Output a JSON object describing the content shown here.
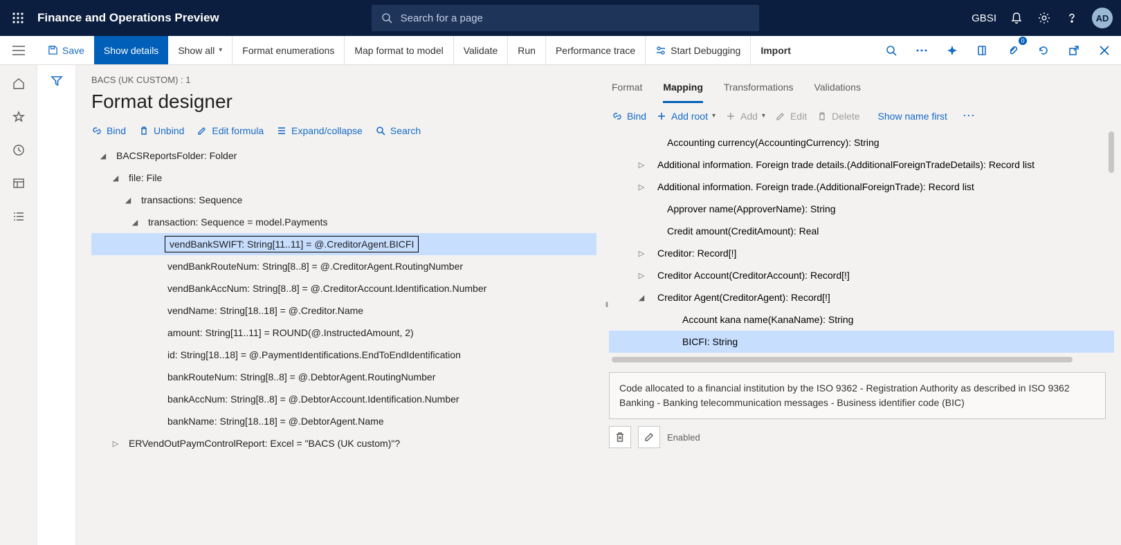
{
  "header": {
    "app_title": "Finance and Operations Preview",
    "search_placeholder": "Search for a page",
    "org": "GBSI",
    "avatar": "AD"
  },
  "commands": {
    "save": "Save",
    "show_details": "Show details",
    "show_all": "Show all",
    "format_enum": "Format enumerations",
    "map_format": "Map format to model",
    "validate": "Validate",
    "run": "Run",
    "perf_trace": "Performance trace",
    "start_debug": "Start Debugging",
    "import": "Import",
    "attach_badge": "0"
  },
  "page": {
    "breadcrumb": "BACS (UK CUSTOM) : 1",
    "title": "Format designer"
  },
  "format_cmds": {
    "bind": "Bind",
    "unbind": "Unbind",
    "edit_formula": "Edit formula",
    "expand": "Expand/collapse",
    "search": "Search"
  },
  "format_tree": [
    {
      "indent": 0,
      "expanded": true,
      "label": "BACSReportsFolder: Folder"
    },
    {
      "indent": 1,
      "expanded": true,
      "label": "file: File"
    },
    {
      "indent": 2,
      "expanded": true,
      "label": "transactions: Sequence"
    },
    {
      "indent": 3,
      "expanded": true,
      "label": "transaction: Sequence = model.Payments"
    },
    {
      "indent": 4,
      "selected": true,
      "label": "vendBankSWIFT: String[11..11] = @.CreditorAgent.BICFI"
    },
    {
      "indent": 4,
      "label": "vendBankRouteNum: String[8..8] = @.CreditorAgent.RoutingNumber"
    },
    {
      "indent": 4,
      "label": "vendBankAccNum: String[8..8] = @.CreditorAccount.Identification.Number"
    },
    {
      "indent": 4,
      "label": "vendName: String[18..18] = @.Creditor.Name"
    },
    {
      "indent": 4,
      "label": "amount: String[11..11] = ROUND(@.InstructedAmount, 2)"
    },
    {
      "indent": 4,
      "label": "id: String[18..18] = @.PaymentIdentifications.EndToEndIdentification"
    },
    {
      "indent": 4,
      "label": "bankRouteNum: String[8..8] = @.DebtorAgent.RoutingNumber"
    },
    {
      "indent": 4,
      "label": "bankAccNum: String[8..8] = @.DebtorAccount.Identification.Number"
    },
    {
      "indent": 4,
      "label": "bankName: String[18..18] = @.DebtorAgent.Name"
    },
    {
      "indent": 1,
      "collapsed": true,
      "label": "ERVendOutPaymControlReport: Excel = \"BACS (UK custom)\"?"
    }
  ],
  "tabs": {
    "format": "Format",
    "mapping": "Mapping",
    "transformations": "Transformations",
    "validations": "Validations"
  },
  "mapping_cmds": {
    "bind": "Bind",
    "add_root": "Add root",
    "add": "Add",
    "edit": "Edit",
    "delete": "Delete",
    "show_name_first": "Show name first"
  },
  "mapping_tree": [
    {
      "indent": 1,
      "label": "Accounting currency(AccountingCurrency): String"
    },
    {
      "indent": 1,
      "collapsed": true,
      "label": "Additional information. Foreign trade details.(AdditionalForeignTradeDetails): Record list"
    },
    {
      "indent": 1,
      "collapsed": true,
      "label": "Additional information. Foreign trade.(AdditionalForeignTrade): Record list"
    },
    {
      "indent": 1,
      "label": "Approver name(ApproverName): String"
    },
    {
      "indent": 1,
      "label": "Credit amount(CreditAmount): Real"
    },
    {
      "indent": 1,
      "collapsed": true,
      "label": "Creditor: Record[!]"
    },
    {
      "indent": 1,
      "collapsed": true,
      "label": "Creditor Account(CreditorAccount): Record[!]"
    },
    {
      "indent": 1,
      "expanded": true,
      "label": "Creditor Agent(CreditorAgent): Record[!]"
    },
    {
      "indent": 2,
      "label": "Account kana name(KanaName): String"
    },
    {
      "indent": 2,
      "selected": true,
      "label": "BICFI: String"
    }
  ],
  "description": "Code allocated to a financial institution by the ISO 9362 - Registration Authority as described in ISO 9362 Banking - Banking telecommunication messages - Business identifier code (BIC)",
  "footer": {
    "enabled": "Enabled"
  }
}
